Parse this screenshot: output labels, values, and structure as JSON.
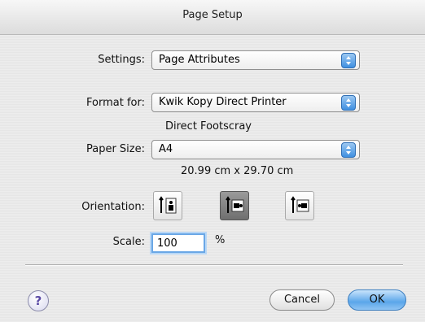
{
  "window": {
    "title": "Page Setup"
  },
  "settings": {
    "label": "Settings:",
    "value": "Page Attributes"
  },
  "format": {
    "label": "Format for:",
    "value": "Kwik Kopy Direct Printer",
    "description": "Direct Footscray"
  },
  "paper": {
    "label": "Paper Size:",
    "value": "A4",
    "dimensions": "20.99 cm x 29.70 cm"
  },
  "orientation": {
    "label": "Orientation:",
    "options": [
      {
        "icon": "portrait-orientation-icon",
        "selected": false
      },
      {
        "icon": "landscape-left-orientation-icon",
        "selected": true
      },
      {
        "icon": "landscape-right-orientation-icon",
        "selected": false
      }
    ]
  },
  "scale": {
    "label": "Scale:",
    "value": "100",
    "unit": "%"
  },
  "buttons": {
    "help": "?",
    "cancel": "Cancel",
    "ok": "OK"
  },
  "colors": {
    "accent": "#5aa6ea",
    "selected_orientation": "#7a7a7a"
  }
}
